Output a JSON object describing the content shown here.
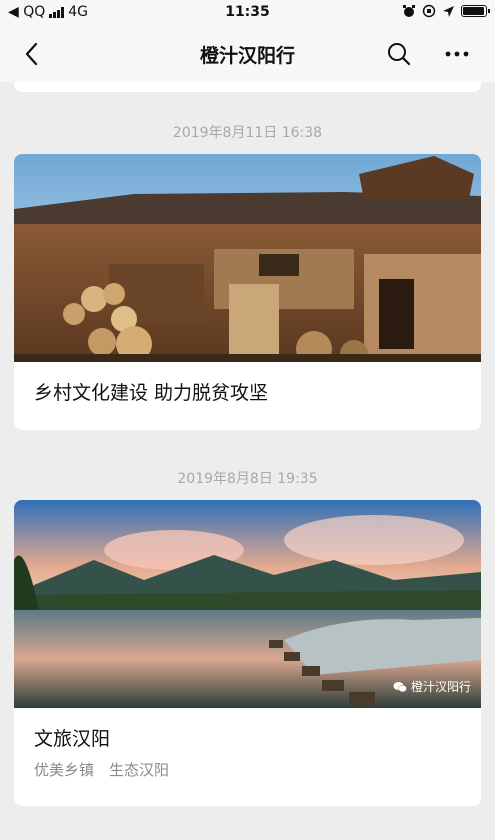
{
  "status_bar": {
    "carrier": "◀ QQ",
    "network": "4G",
    "time": "11:35"
  },
  "navbar": {
    "title": "橙汁汉阳行",
    "back_icon": "chevron-left-icon",
    "search_icon": "search-icon",
    "more_icon": "more-icon"
  },
  "messages": [
    {
      "timestamp": "2019年8月11日 16:38",
      "title": "乡村文化建设 助力脱贫攻坚",
      "subtitle": ""
    },
    {
      "timestamp": "2019年8月8日 19:35",
      "title": "文旅汉阳",
      "subtitle": "优美乡镇　生态汉阳",
      "watermark": "橙汁汉阳行"
    }
  ]
}
